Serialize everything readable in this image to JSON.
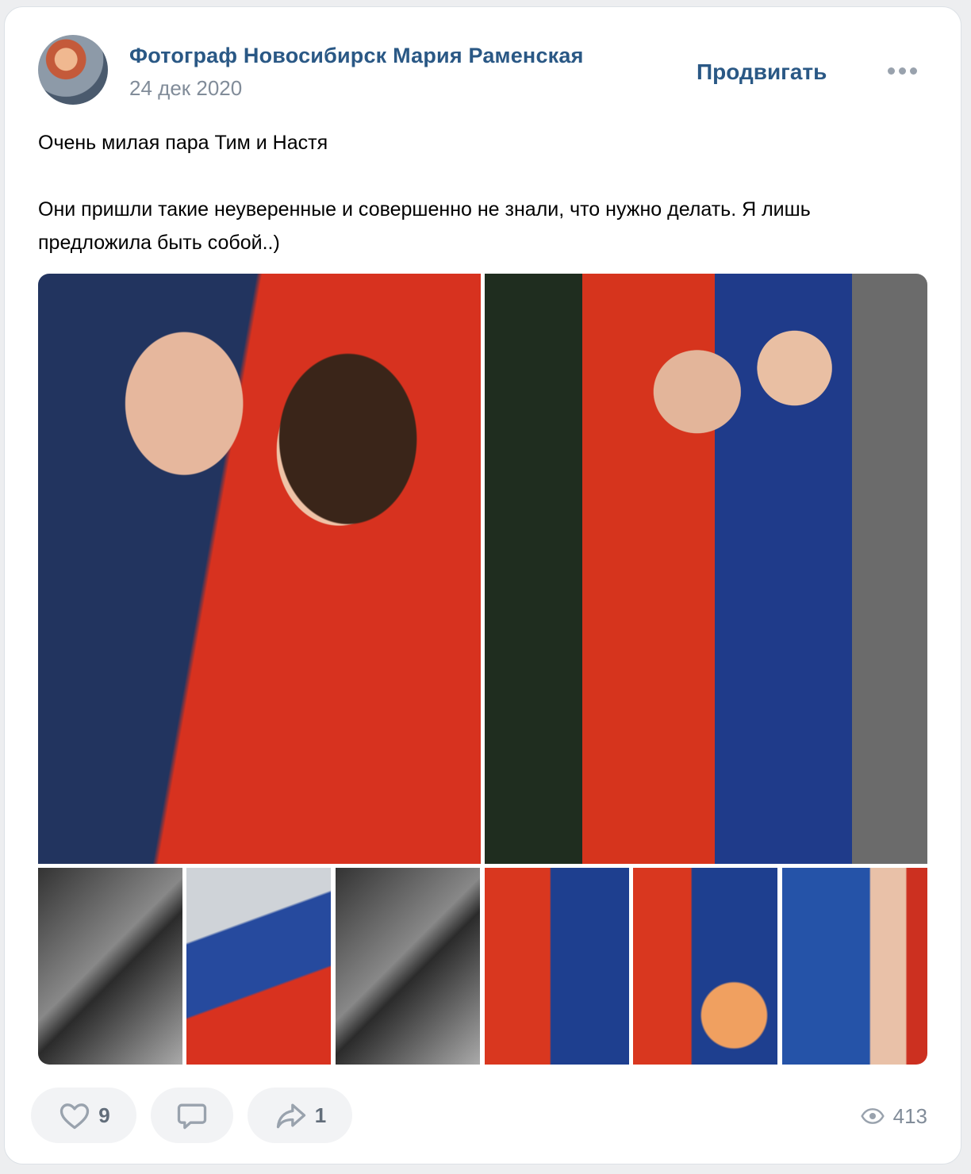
{
  "post": {
    "author": "Фотограф Новосибирск Мария Раменская",
    "date": "24 дек 2020",
    "promote_label": "Продвигать",
    "text_line1": "Очень милая пара Тим и Настя",
    "text_line2": "Они пришли такие неуверенные и совершенно не знали, что нужно делать. Я лишь предложила быть собой..)"
  },
  "actions": {
    "likes": "9",
    "shares": "1",
    "views": "413"
  },
  "icons": {
    "more": "more-horizontal-icon",
    "like": "heart-icon",
    "comment": "comment-icon",
    "share": "share-arrow-icon",
    "views": "eye-icon"
  },
  "colors": {
    "link": "#2a5885",
    "secondary": "#818c99",
    "button_bg": "#f2f3f5"
  }
}
